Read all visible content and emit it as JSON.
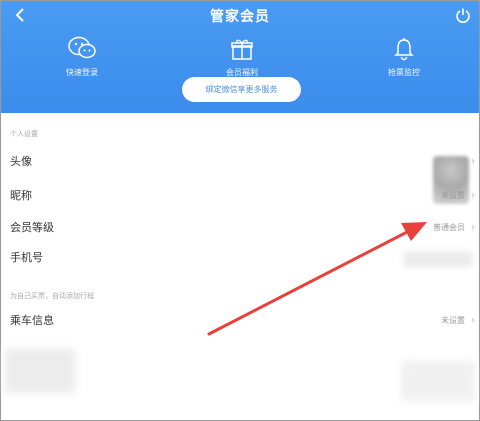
{
  "header": {
    "title": "管家会员",
    "features": [
      {
        "label": "快速登录",
        "icon": "wechat-icon"
      },
      {
        "label": "会员福利",
        "icon": "gift-icon"
      },
      {
        "label": "抢票监控",
        "icon": "bell-icon"
      }
    ],
    "bind_button": "绑定微信享更多服务"
  },
  "sections": {
    "personal_title": "个人设置",
    "trip_title": "为自己买票，自动添加行程"
  },
  "rows": {
    "avatar": "头像",
    "nickname": "昵称",
    "nickname_value": "未设置",
    "level": "会员等级",
    "level_value": "普通会员",
    "phone": "手机号",
    "passenger": "乘车信息",
    "passenger_value": "未设置"
  },
  "colors": {
    "header": "#3b8cec",
    "accent": "#e8403a"
  }
}
